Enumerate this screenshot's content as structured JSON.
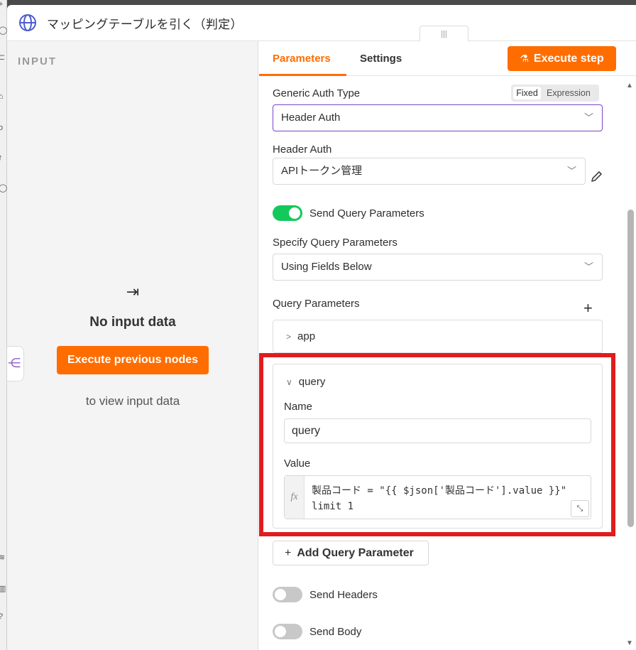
{
  "node": {
    "title": "マッピングテーブルを引く（判定）",
    "icon": "globe-icon"
  },
  "input_panel": {
    "label": "INPUT",
    "no_input": "No input data",
    "execute_previous": "Execute previous nodes",
    "to_view": "to view input data"
  },
  "tabs": {
    "parameters": "Parameters",
    "settings": "Settings",
    "active": "Parameters"
  },
  "execute_step": "Execute step",
  "params": {
    "generic_auth_type": {
      "label": "Generic Auth Type",
      "value": "Header Auth",
      "mode_fixed": "Fixed",
      "mode_expression": "Expression"
    },
    "header_auth": {
      "label": "Header Auth",
      "value": "APIトークン管理"
    },
    "send_query": {
      "label": "Send Query Parameters",
      "on": true
    },
    "specify_query": {
      "label": "Specify Query Parameters",
      "value": "Using Fields Below"
    },
    "query_params": {
      "label": "Query Parameters",
      "items": [
        {
          "title": "app",
          "expanded": false
        },
        {
          "title": "query",
          "expanded": true,
          "name_label": "Name",
          "name_value": "query",
          "value_label": "Value",
          "value_line1": "製品コード = \"{{ $json['製品コード'].value }}\"",
          "value_line2": "limit 1"
        }
      ]
    },
    "add_query_param": "Add Query Parameter",
    "send_headers": {
      "label": "Send Headers",
      "on": false
    },
    "send_body": {
      "label": "Send Body",
      "on": false
    }
  },
  "colors": {
    "accent": "#ff6d00",
    "toggle_on": "#13c95b",
    "focus_border": "#7b43c9",
    "highlight": "#e01d1d"
  }
}
